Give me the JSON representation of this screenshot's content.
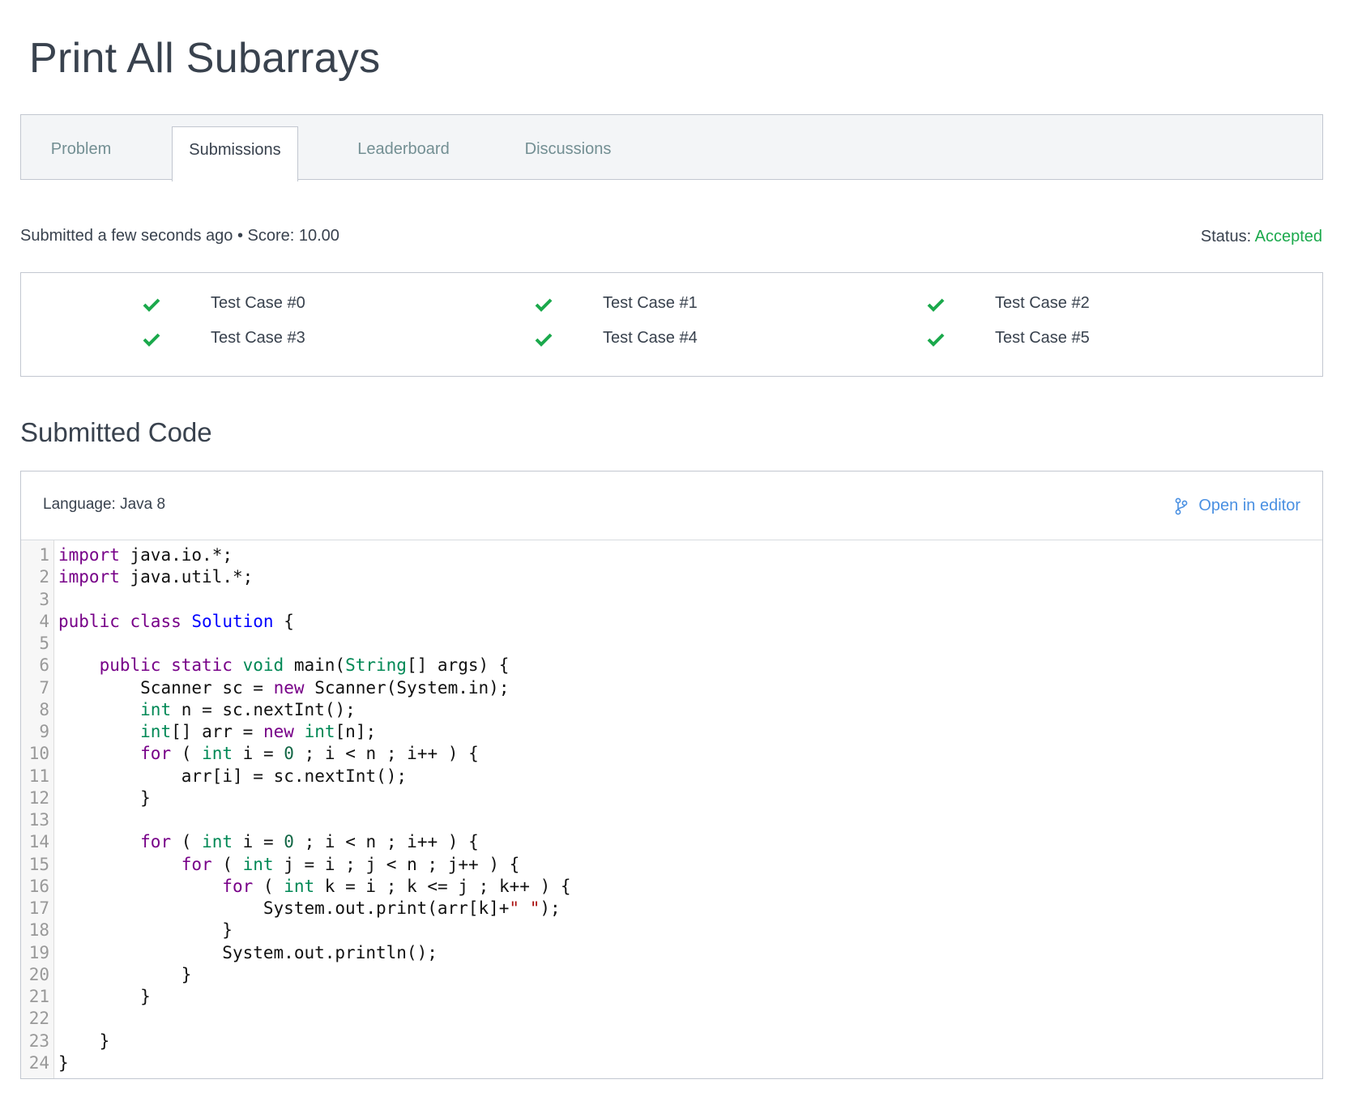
{
  "title": "Print All Subarrays",
  "tabs": [
    {
      "label": "Problem",
      "active": false
    },
    {
      "label": "Submissions",
      "active": true
    },
    {
      "label": "Leaderboard",
      "active": false
    },
    {
      "label": "Discussions",
      "active": false
    }
  ],
  "submission": {
    "submitted_text": "Submitted a few seconds ago • Score: 10.00",
    "status_label": "Status:",
    "status_value": "Accepted",
    "status_color": "#1ba94c"
  },
  "test_cases": [
    {
      "label": "Test Case #0",
      "passed": true,
      "icon": "check-icon"
    },
    {
      "label": "Test Case #1",
      "passed": true,
      "icon": "check-icon"
    },
    {
      "label": "Test Case #2",
      "passed": true,
      "icon": "check-icon"
    },
    {
      "label": "Test Case #3",
      "passed": true,
      "icon": "check-icon"
    },
    {
      "label": "Test Case #4",
      "passed": true,
      "icon": "check-icon"
    },
    {
      "label": "Test Case #5",
      "passed": true,
      "icon": "check-icon"
    }
  ],
  "code_section": {
    "heading": "Submitted Code",
    "language": "Language: Java 8",
    "open_in_editor": "Open in editor",
    "open_icon": "branch-icon",
    "lines": [
      "import java.io.*;",
      "import java.util.*;",
      "",
      "public class Solution {",
      "",
      "    public static void main(String[] args) {",
      "        Scanner sc = new Scanner(System.in);",
      "        int n = sc.nextInt();",
      "        int[] arr = new int[n];",
      "        for ( int i = 0 ; i < n ; i++ ) {",
      "            arr[i] = sc.nextInt();",
      "        }",
      "",
      "        for ( int i = 0 ; i < n ; i++ ) {",
      "            for ( int j = i ; j < n ; j++ ) {",
      "                for ( int k = i ; k <= j ; k++ ) {",
      "                    System.out.print(arr[k]+\" \");",
      "                }",
      "                System.out.println();",
      "            }",
      "        }",
      "",
      "    }",
      "}"
    ]
  }
}
